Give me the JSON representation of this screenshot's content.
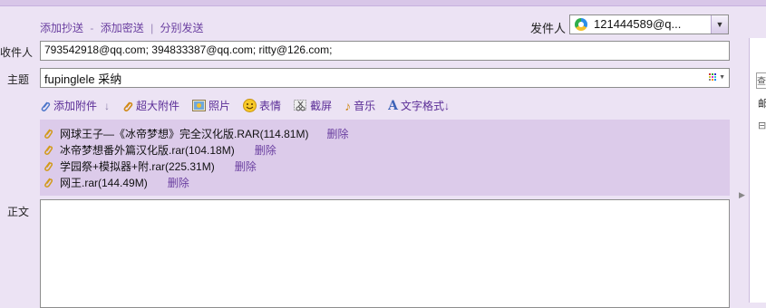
{
  "compose": {
    "links": {
      "add_cc": "添加抄送",
      "dash": "-",
      "add_bcc": "添加密送",
      "separator": "|",
      "send_separately": "分别发送"
    },
    "sender": {
      "label": "发件人",
      "value": "121444589@q...",
      "icon": "qq-icon"
    },
    "recipients": {
      "label": "收件人",
      "value": "793542918@qq.com;  394833387@qq.com;  ritty@126.com;"
    },
    "subject": {
      "label": "主题",
      "value": "fupinglele 采纳",
      "icon": "color-grid-icon"
    },
    "toolbar": {
      "add_attachment": "添加附件",
      "add_attachment_arrow": "↓",
      "super_attachment": "超大附件",
      "photo": "照片",
      "emoji": "表情",
      "screenshot": "截屏",
      "music": "音乐",
      "text_format": "文字格式",
      "text_format_arrow": "↓"
    },
    "attachments": [
      {
        "name": "网球王子—《冰帝梦想》完全汉化版.RAR(114.81M)",
        "delete": "删除"
      },
      {
        "name": "冰帝梦想番外篇汉化版.rar(104.18M)",
        "delete": "删除"
      },
      {
        "name": "学园祭+模拟器+附.rar(225.31M)",
        "delete": "删除"
      },
      {
        "name": "网王.rar(144.49M)",
        "delete": "删除"
      }
    ],
    "body": {
      "label": "正文",
      "value": ""
    },
    "right_panel": {
      "box_text": "查",
      "label": "邮",
      "tree_toggle": "⊟"
    },
    "colors": {
      "background": "#ece3f4",
      "attachment_panel": "#dccbea",
      "link": "#6a3fa0"
    }
  }
}
